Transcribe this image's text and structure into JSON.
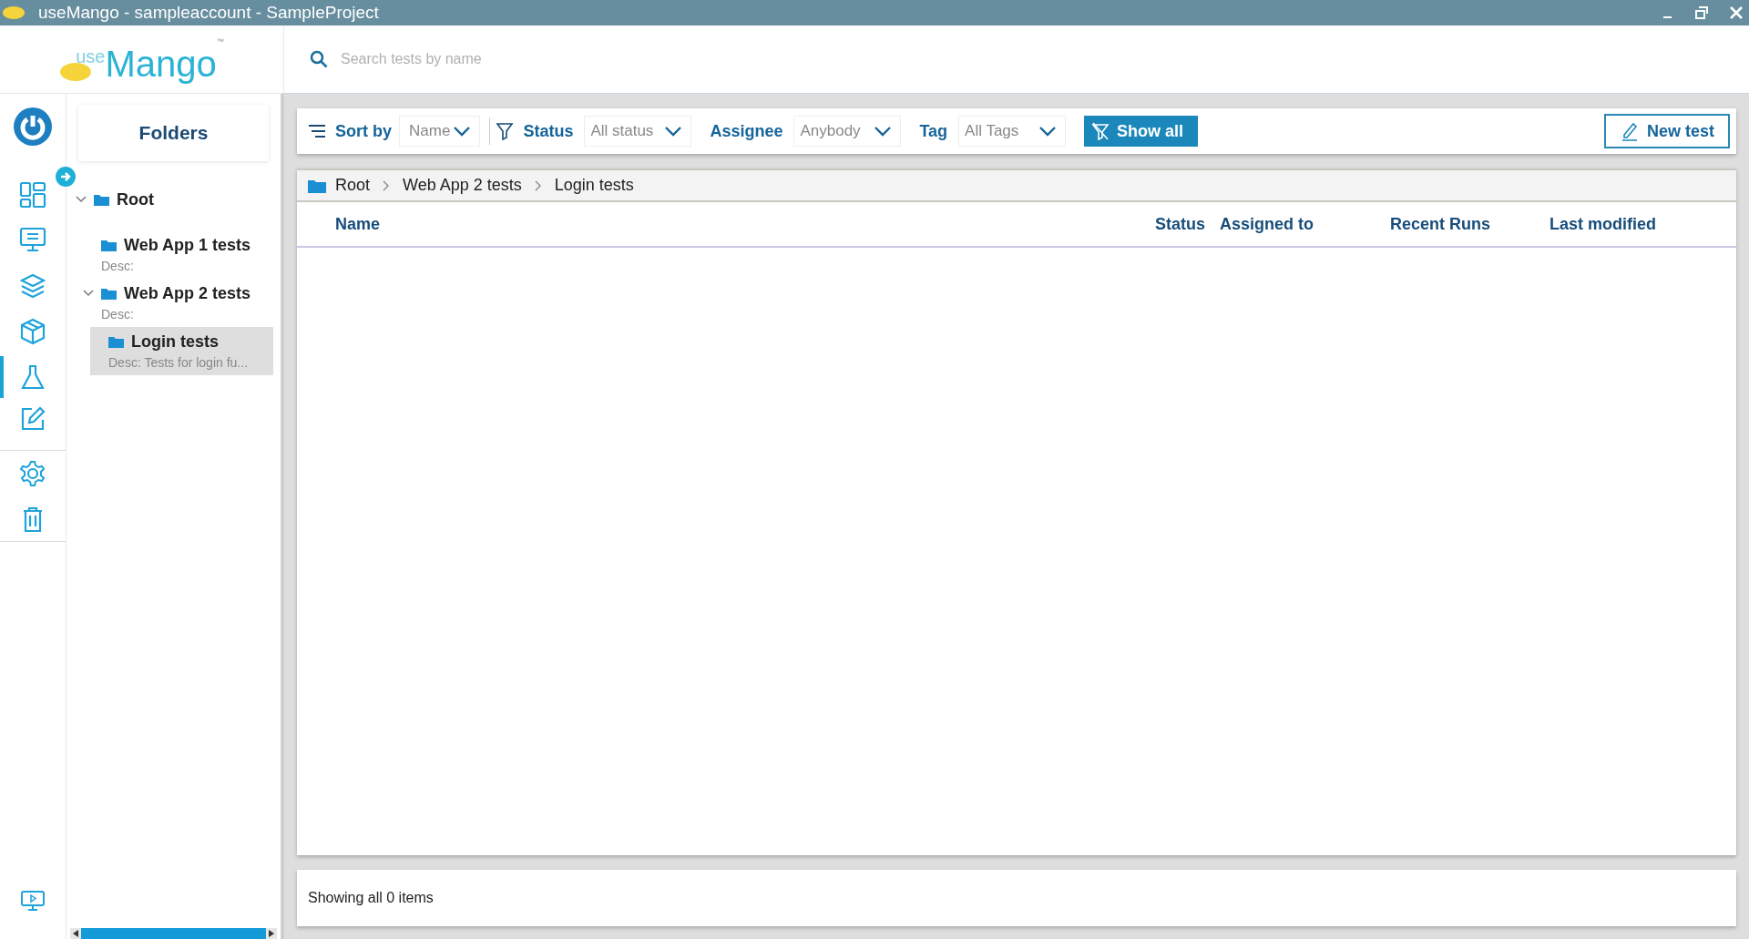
{
  "window": {
    "title": "useMango - sampleaccount - SampleProject"
  },
  "logo": {
    "prefix": "use",
    "name": "Mango",
    "mark": "™"
  },
  "search": {
    "placeholder": "Search tests by name"
  },
  "nav_items": [
    {
      "selected": false
    },
    {
      "selected": false
    },
    {
      "selected": false
    },
    {
      "selected": false
    },
    {
      "selected": true
    },
    {
      "selected": false
    },
    {
      "selected": false
    },
    {
      "selected": false
    }
  ],
  "folders_panel": {
    "title": "Folders",
    "tree": [
      {
        "label": "Root",
        "expanded": true,
        "selected": false,
        "children": [
          {
            "label": "Web App 1 tests",
            "description": "Desc:",
            "selected": false
          },
          {
            "label": "Web App 2 tests",
            "description": "Desc:",
            "expanded": true,
            "selected": false,
            "children": [
              {
                "label": "Login tests",
                "description": "Desc: Tests for login fu...",
                "selected": true
              }
            ]
          }
        ]
      }
    ]
  },
  "toolbar": {
    "sort": {
      "label": "Sort by",
      "value": "Name"
    },
    "filters": [
      {
        "label": "Status",
        "value": "All status"
      },
      {
        "label": "Assignee",
        "value": "Anybody"
      },
      {
        "label": "Tag",
        "value": "All Tags"
      }
    ],
    "show_all": "Show all",
    "new_test": "New test"
  },
  "breadcrumb": [
    "Root",
    "Web App 2 tests",
    "Login tests"
  ],
  "table": {
    "columns": [
      "Name",
      "Status",
      "Assigned to",
      "Recent Runs",
      "Last modified"
    ]
  },
  "status_bar": "Showing all 0 items"
}
